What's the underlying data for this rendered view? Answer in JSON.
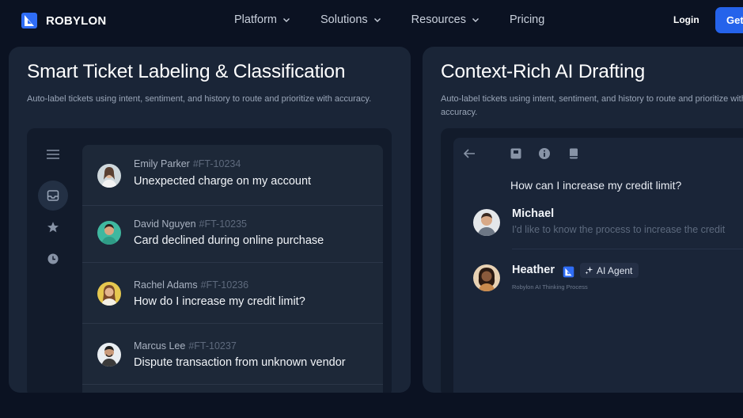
{
  "brand": {
    "name": "ROBYLON",
    "accent": "#2563eb"
  },
  "nav": {
    "links": [
      {
        "label": "Platform",
        "has_dropdown": true
      },
      {
        "label": "Solutions",
        "has_dropdown": true
      },
      {
        "label": "Resources",
        "has_dropdown": true
      },
      {
        "label": "Pricing",
        "has_dropdown": false
      }
    ],
    "login_label": "Login",
    "cta_label": "Get"
  },
  "cards": [
    {
      "title": "Smart Ticket Labeling & Classification",
      "description": "Auto-label tickets using intent, sentiment, and history to route and prioritize with accuracy.",
      "sidebar_icons": [
        "menu-icon",
        "inbox-icon",
        "star-icon",
        "clock-icon"
      ],
      "tickets": [
        {
          "name": "Emily Parker",
          "id": "#FT-10234",
          "subject": "Unexpected charge on my account"
        },
        {
          "name": "David Nguyen",
          "id": "#FT-10235",
          "subject": "Card declined during online purchase"
        },
        {
          "name": "Rachel Adams",
          "id": "#FT-10236",
          "subject": "How do I increase my credit limit?"
        },
        {
          "name": "Marcus Lee",
          "id": "#FT-10237",
          "subject": "Dispute transaction from unknown vendor"
        }
      ]
    },
    {
      "title": "Context-Rich AI Drafting",
      "description": "Auto-label tickets using intent, sentiment, and history to route and prioritize with accuracy.",
      "toolbar_icons": [
        "back-arrow-icon",
        "save-icon",
        "info-icon",
        "document-icon"
      ],
      "question": "How can I increase my credit limit?",
      "customer": {
        "name": "Michael",
        "message": "I'd like to know the process to increase the credit"
      },
      "agent": {
        "name": "Heather",
        "badge": "AI Agent",
        "status": "Robylon AI Thinking Process"
      }
    }
  ]
}
